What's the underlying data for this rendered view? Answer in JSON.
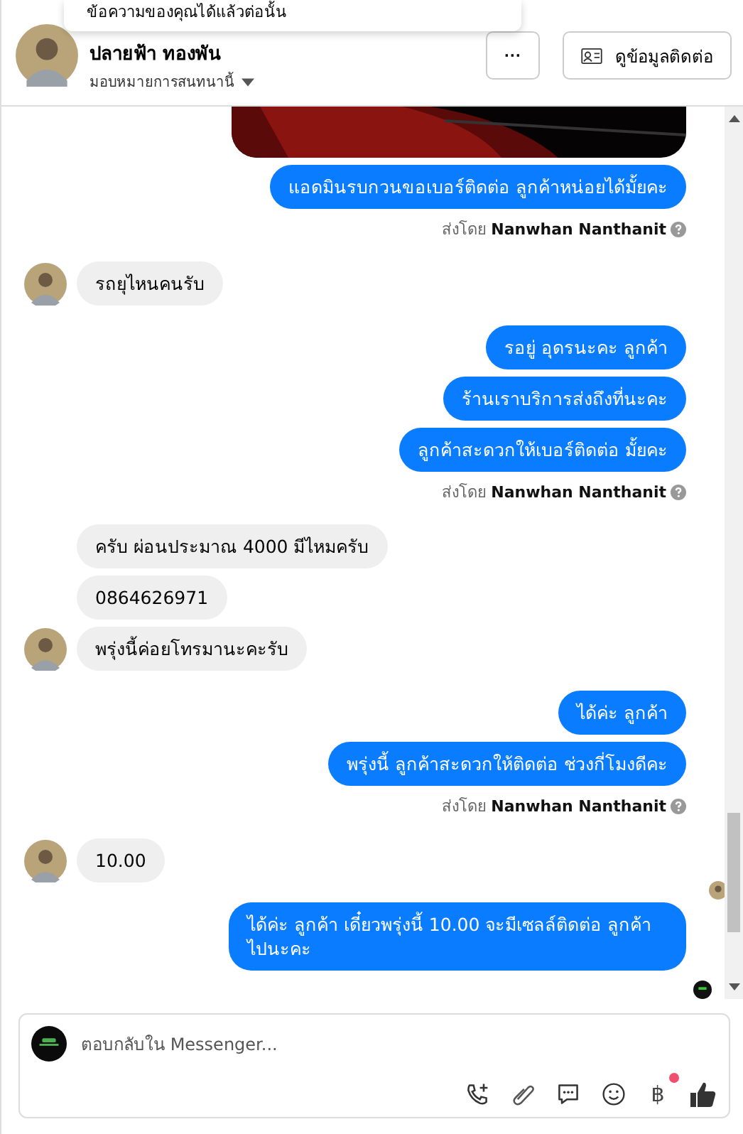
{
  "tooltip": {
    "text": "ข้อความของคุณได้แล้วต่อนั้น"
  },
  "header": {
    "name": "ปลายฟ้า ทองพัน",
    "assign_label": "มอบหมายการสนทนานี้",
    "more_button": "···",
    "contact_button": "ดูข้อมูลติดต่อ"
  },
  "messages": [
    {
      "kind": "picture"
    },
    {
      "kind": "outgoing",
      "text": "แอดมินรบกวนขอเบอร์ติดต่อ ลูกค้าหน่อยได้มั้ยคะ"
    },
    {
      "kind": "sent_by",
      "label": "ส่งโดย",
      "name": "Nanwhan Nanthanit"
    },
    {
      "kind": "incoming",
      "text": "รถยุไหนคนรับ",
      "avatar": true,
      "seen": false
    },
    {
      "kind": "outgoing",
      "text": "รอยู่ อุดรนะคะ ลูกค้า"
    },
    {
      "kind": "outgoing",
      "text": "ร้านเราบริการส่งถึงที่นะคะ"
    },
    {
      "kind": "outgoing",
      "text": "ลูกค้าสะดวกให้เบอร์ติดต่อ มั้ยคะ"
    },
    {
      "kind": "sent_by",
      "label": "ส่งโดย",
      "name": "Nanwhan Nanthanit"
    },
    {
      "kind": "incoming",
      "text": "ครับ ผ่อนประมาณ  4000  มีไหมครับ",
      "avatar": false,
      "seen": false
    },
    {
      "kind": "incoming",
      "text": "0864626971",
      "avatar": false,
      "seen": false
    },
    {
      "kind": "incoming",
      "text": "พรุ่งนี้ค่อยโทรมานะคะรับ",
      "avatar": true,
      "seen": false
    },
    {
      "kind": "outgoing",
      "text": "ได้ค่ะ ลูกค้า"
    },
    {
      "kind": "outgoing",
      "text": "พรุ่งนี้ ลูกค้าสะดวกให้ติดต่อ ช่วงกี่โมงดีคะ"
    },
    {
      "kind": "sent_by",
      "label": "ส่งโดย",
      "name": "Nanwhan Nanthanit"
    },
    {
      "kind": "incoming",
      "text": "10.00",
      "avatar": true,
      "seen": true
    },
    {
      "kind": "outgoing",
      "text": "ได้ค่ะ ลูกค้า เดี๋ยวพรุ่งนี้ 10.00 จะมีเซลล์ติดต่อ ลูกค้าไปนะคะ"
    }
  ],
  "composer": {
    "placeholder": "ตอบกลับใน Messenger...",
    "payment_icon": "฿",
    "payment_badge": true
  }
}
